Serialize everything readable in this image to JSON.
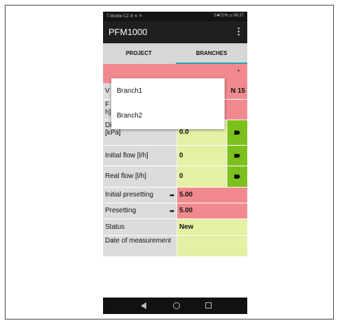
{
  "statusbar": {
    "carrier": "T-Mobile CZ",
    "signal": "ıll ≋ ⚞",
    "right": "⏱✱72% ▭ 08:27"
  },
  "appbar": {
    "title": "PFM1000",
    "menu": "⋮"
  },
  "tabs": [
    {
      "label": "PROJECT",
      "selected": false
    },
    {
      "label": "BRANCHES",
      "selected": true
    }
  ],
  "selector": {
    "caret": "▾"
  },
  "dropdown": {
    "options": [
      "Branch1",
      "Branch2"
    ]
  },
  "partial": {
    "v_label": "V",
    "f_label": "F",
    "h_label": "h]",
    "value_fragment": "N 15"
  },
  "rows": [
    {
      "label": "Disposal pressure [kPa]",
      "value": "0.0"
    },
    {
      "label": "Initial flow [l/h]",
      "value": "0"
    },
    {
      "label": "Real flow [l/h]",
      "value": "0"
    },
    {
      "label": "Initial presetting",
      "value": "5.00"
    },
    {
      "label": "Presetting",
      "value": "5.00"
    },
    {
      "label": "Status",
      "value": "New"
    },
    {
      "label": "Date of measurement",
      "value": ""
    }
  ],
  "icons": {
    "arrow_right": "➡",
    "tag": "tag-icon"
  },
  "colors": {
    "pink": "#f18a8f",
    "green_light": "#e4f0a4",
    "green": "#7cc01c",
    "accent": "#1aa6b6",
    "appbar": "#1f1f1f"
  }
}
